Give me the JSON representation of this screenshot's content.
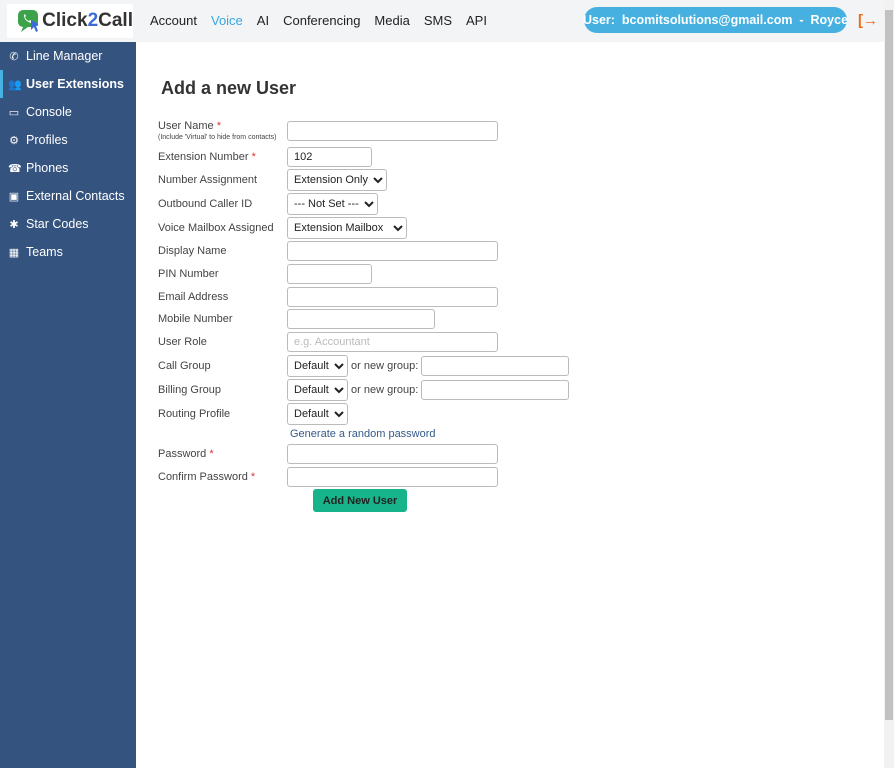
{
  "logo": {
    "text_a": "Click",
    "text_b": "2",
    "text_c": "Call"
  },
  "nav": [
    "Account",
    "Voice",
    "AI",
    "Conferencing",
    "Media",
    "SMS",
    "API"
  ],
  "nav_active": "Voice",
  "user_pill": "User:  bcomitsolutions@gmail.com  -  Royce",
  "sidebar": [
    {
      "label": "Line Manager",
      "icon": "phone-icon"
    },
    {
      "label": "User Extensions",
      "icon": "users-icon",
      "active": true
    },
    {
      "label": "Console",
      "icon": "monitor-icon"
    },
    {
      "label": "Profiles",
      "icon": "gears-icon"
    },
    {
      "label": "Phones",
      "icon": "phone-square-icon"
    },
    {
      "label": "External Contacts",
      "icon": "address-book-icon"
    },
    {
      "label": "Star Codes",
      "icon": "asterisk-icon"
    },
    {
      "label": "Teams",
      "icon": "teams-icon"
    }
  ],
  "form": {
    "title": "Add a new User",
    "user_name": {
      "label": "User Name",
      "hint": "(Include 'Virtual' to hide from contacts)",
      "value": ""
    },
    "extension_number": {
      "label": "Extension Number",
      "value": "102"
    },
    "number_assignment": {
      "label": "Number Assignment",
      "value": "Extension Only"
    },
    "outbound_caller_id": {
      "label": "Outbound Caller ID",
      "value": "--- Not Set ---"
    },
    "voice_mailbox": {
      "label": "Voice Mailbox Assigned",
      "value": "Extension Mailbox"
    },
    "display_name": {
      "label": "Display Name",
      "value": ""
    },
    "pin": {
      "label": "PIN Number",
      "value": ""
    },
    "email": {
      "label": "Email Address",
      "value": ""
    },
    "mobile": {
      "label": "Mobile Number",
      "value": ""
    },
    "user_role": {
      "label": "User Role",
      "placeholder": "e.g. Accountant"
    },
    "call_group": {
      "label": "Call Group",
      "value": "Default"
    },
    "billing_group": {
      "label": "Billing Group",
      "value": "Default"
    },
    "routing_profile": {
      "label": "Routing Profile",
      "value": "Default"
    },
    "or_new_group": "or new group:",
    "generate_link": "Generate a random password",
    "password": {
      "label": "Password"
    },
    "confirm_password": {
      "label": "Confirm Password"
    },
    "required_mark": "*",
    "submit": "Add New User"
  },
  "colors": {
    "sidebar": "#35537f",
    "accent": "#46b1e1",
    "button": "#17b48c",
    "logout": "#f06a1a"
  }
}
